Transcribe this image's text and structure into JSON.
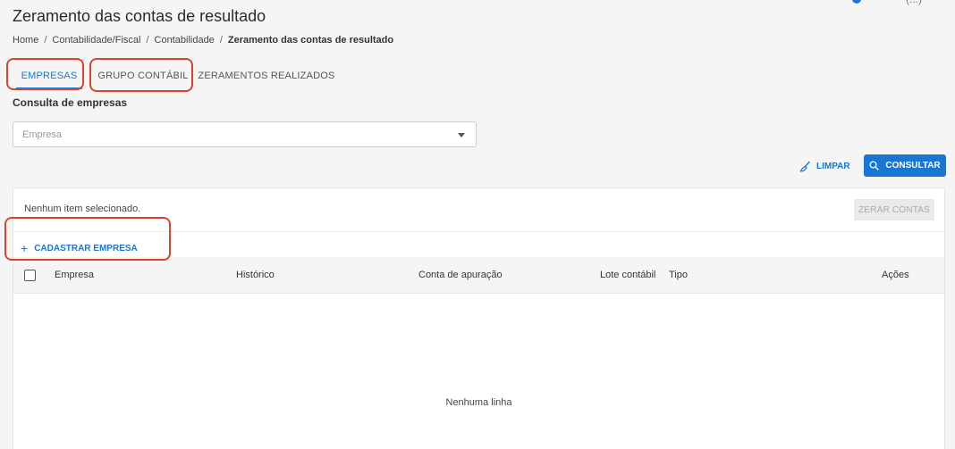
{
  "page": {
    "title": "Zeramento das contas de resultado",
    "user_text": "(...)"
  },
  "breadcrumb": {
    "items": [
      "Home",
      "Contabilidade/Fiscal",
      "Contabilidade"
    ],
    "separator": "/",
    "current": "Zeramento das contas de resultado"
  },
  "tabs": [
    {
      "label": "EMPRESAS",
      "active": true
    },
    {
      "label": "GRUPO CONTÁBIL",
      "active": false
    },
    {
      "label": "ZERAMENTOS REALIZADOS",
      "active": false
    }
  ],
  "search": {
    "section_label": "Consulta de empresas",
    "placeholder": "Empresa"
  },
  "actions": {
    "clear_label": "LIMPAR",
    "query_label": "CONSULTAR"
  },
  "panel": {
    "selection_info": "Nenhum item selecionado.",
    "zero_button": "ZERAR CONTAS",
    "add_label": "CADASTRAR EMPRESA",
    "add_icon": "+",
    "columns": [
      "Empresa",
      "Histórico",
      "Conta de apuração",
      "Lote contábil",
      "Tipo",
      "Ações"
    ],
    "empty_message": "Nenhuma linha"
  },
  "colors": {
    "primary": "#1976d2",
    "highlight": "#d9432f",
    "background": "#f5f5f5"
  },
  "icons": {
    "clear": "broom-icon",
    "query": "search-icon",
    "dropdown": "chevron-down-icon",
    "add": "plus-icon"
  }
}
